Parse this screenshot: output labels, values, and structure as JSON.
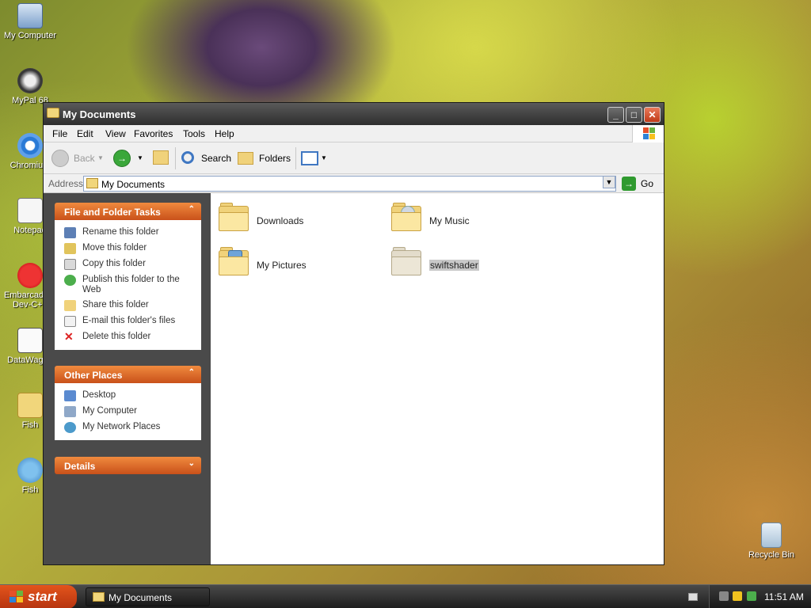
{
  "desktop": {
    "icons": [
      {
        "label": "My Computer",
        "icon": "my-computer-icon"
      },
      {
        "label": "MyPal 68",
        "icon": "mypal-icon"
      },
      {
        "label": "Chromium",
        "icon": "chromium-icon"
      },
      {
        "label": "Notepad",
        "icon": "notepad-icon"
      },
      {
        "label": "Embarcadero Dev-C++",
        "icon": "devcpp-icon"
      },
      {
        "label": "DataWagon",
        "icon": "datawagon-icon"
      },
      {
        "label": "Fish",
        "icon": "fish-zip-icon"
      },
      {
        "label": "Fish",
        "icon": "fish-icon"
      },
      {
        "label": "Recycle Bin",
        "icon": "recycle-bin-icon"
      }
    ]
  },
  "window": {
    "title": "My Documents",
    "menu": [
      "File",
      "Edit",
      "View",
      "Favorites",
      "Tools",
      "Help"
    ],
    "toolbar": {
      "back": "Back",
      "search": "Search",
      "folders": "Folders"
    },
    "address": {
      "label": "Address",
      "value": "My Documents",
      "go": "Go"
    },
    "tasks": {
      "file_folder": {
        "title": "File and Folder Tasks",
        "items": [
          "Rename this folder",
          "Move this folder",
          "Copy this folder",
          "Publish this folder to the Web",
          "Share this folder",
          "E-mail this folder's files",
          "Delete this folder"
        ]
      },
      "other_places": {
        "title": "Other Places",
        "items": [
          "Desktop",
          "My Computer",
          "My Network Places"
        ]
      },
      "details": {
        "title": "Details"
      }
    },
    "files": [
      {
        "name": "Downloads",
        "icon": "folder-icon"
      },
      {
        "name": "My Music",
        "icon": "music-folder-icon"
      },
      {
        "name": "My Pictures",
        "icon": "pictures-folder-icon"
      },
      {
        "name": "swiftshader",
        "icon": "folder-icon",
        "selected": true
      }
    ]
  },
  "taskbar": {
    "start": "start",
    "tasks": [
      "My Documents"
    ],
    "clock": "11:51 AM"
  },
  "colors": {
    "task_header": "#e06a28",
    "start_button": "#d44a18",
    "selection": "#c8c8c8"
  }
}
